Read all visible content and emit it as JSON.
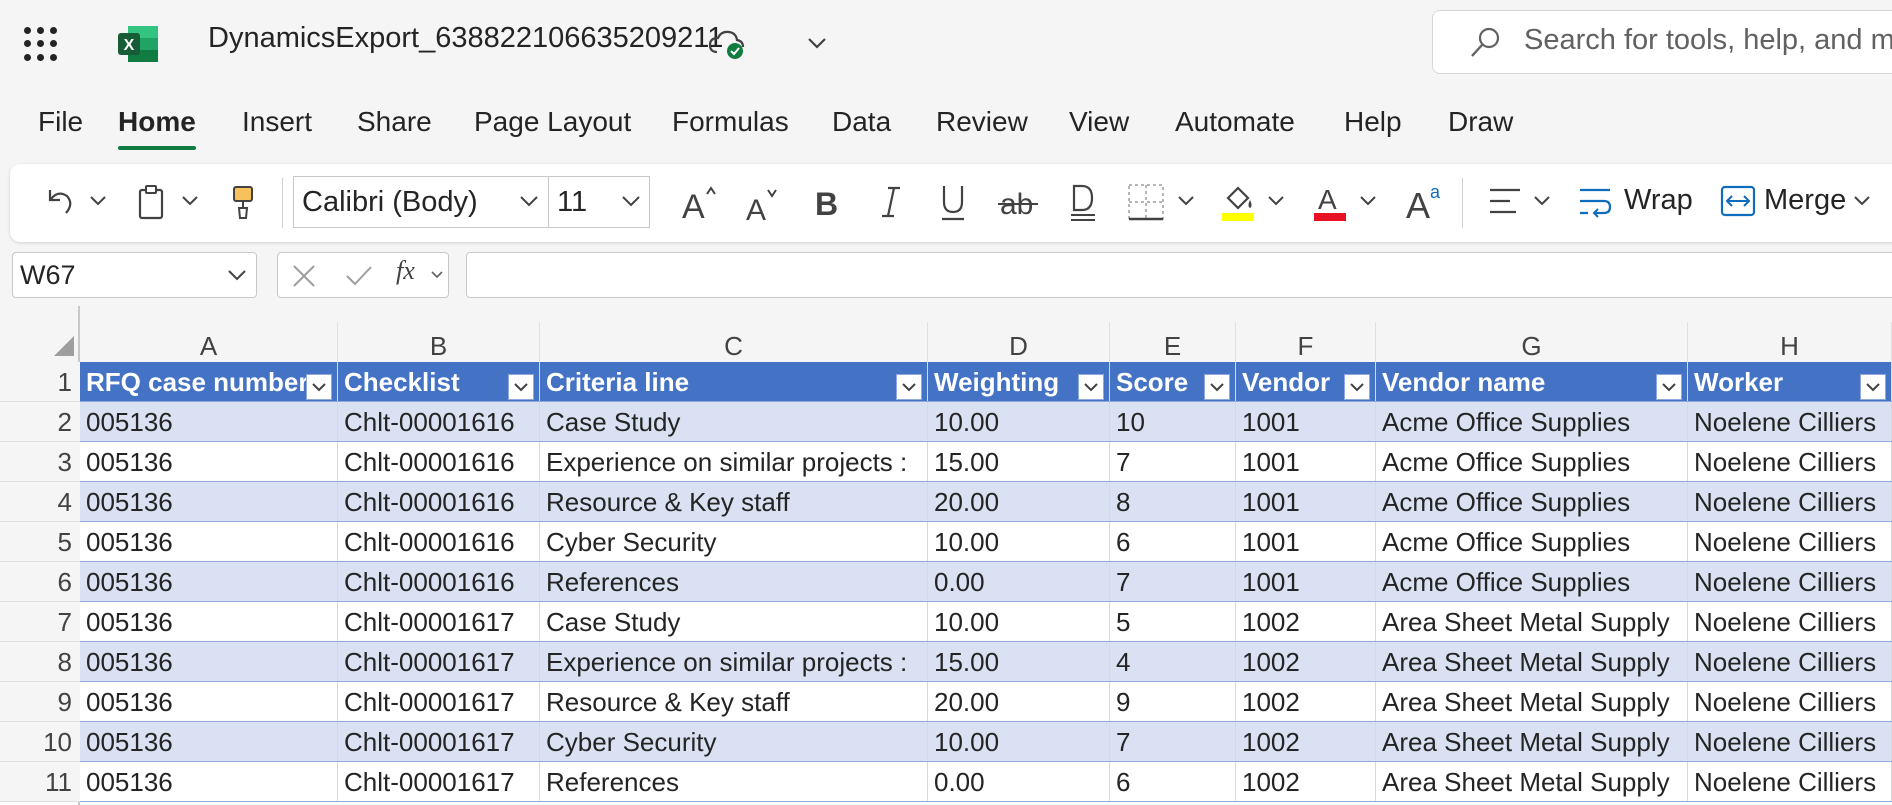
{
  "title_bar": {
    "doc_title": "DynamicsExport_638822106635209211",
    "search_placeholder": "Search for tools, help, and mo"
  },
  "tabs": [
    "File",
    "Home",
    "Insert",
    "Share",
    "Page Layout",
    "Formulas",
    "Data",
    "Review",
    "View",
    "Automate",
    "Help",
    "Draw"
  ],
  "active_tab": "Home",
  "ribbon": {
    "font_name": "Calibri (Body)",
    "font_size": "11",
    "wrap_label": "Wrap",
    "merge_label": "Merge",
    "accent_green": "#107c41",
    "highlight_color": "#ffff00",
    "font_color": "#e81123"
  },
  "formula_bar": {
    "name_box": "W67",
    "fx_label": "fx",
    "formula": ""
  },
  "columns": [
    "A",
    "B",
    "C",
    "D",
    "E",
    "F",
    "G",
    "H"
  ],
  "table": {
    "header_color": "#4472c4",
    "band_color": "#d9e1f2",
    "headers": [
      "RFQ case number",
      "Checklist",
      "Criteria line",
      "Weighting",
      "Score",
      "Vendor",
      "Vendor name",
      "Worker"
    ],
    "rows": [
      {
        "num": "2",
        "cells": [
          "005136",
          "Chlt-00001616",
          "Case Study",
          "10.00",
          "10",
          "1001",
          "Acme Office Supplies",
          "Noelene Cilliers"
        ]
      },
      {
        "num": "3",
        "cells": [
          "005136",
          "Chlt-00001616",
          "Experience on similar projects :",
          "15.00",
          "7",
          "1001",
          "Acme Office Supplies",
          "Noelene Cilliers"
        ]
      },
      {
        "num": "4",
        "cells": [
          "005136",
          "Chlt-00001616",
          "Resource & Key staff",
          "20.00",
          "8",
          "1001",
          "Acme Office Supplies",
          "Noelene Cilliers"
        ]
      },
      {
        "num": "5",
        "cells": [
          "005136",
          "Chlt-00001616",
          "Cyber Security",
          "10.00",
          "6",
          "1001",
          "Acme Office Supplies",
          "Noelene Cilliers"
        ]
      },
      {
        "num": "6",
        "cells": [
          "005136",
          "Chlt-00001616",
          "References",
          "0.00",
          "7",
          "1001",
          "Acme Office Supplies",
          "Noelene Cilliers"
        ]
      },
      {
        "num": "7",
        "cells": [
          "005136",
          "Chlt-00001617",
          "Case Study",
          "10.00",
          "5",
          "1002",
          "Area Sheet Metal Supply",
          "Noelene Cilliers"
        ]
      },
      {
        "num": "8",
        "cells": [
          "005136",
          "Chlt-00001617",
          "Experience on similar projects :",
          "15.00",
          "4",
          "1002",
          "Area Sheet Metal Supply",
          "Noelene Cilliers"
        ]
      },
      {
        "num": "9",
        "cells": [
          "005136",
          "Chlt-00001617",
          "Resource & Key staff",
          "20.00",
          "9",
          "1002",
          "Area Sheet Metal Supply",
          "Noelene Cilliers"
        ]
      },
      {
        "num": "10",
        "cells": [
          "005136",
          "Chlt-00001617",
          "Cyber Security",
          "10.00",
          "7",
          "1002",
          "Area Sheet Metal Supply",
          "Noelene Cilliers"
        ]
      },
      {
        "num": "11",
        "cells": [
          "005136",
          "Chlt-00001617",
          "References",
          "0.00",
          "6",
          "1002",
          "Area Sheet Metal Supply",
          "Noelene Cilliers"
        ]
      }
    ]
  }
}
